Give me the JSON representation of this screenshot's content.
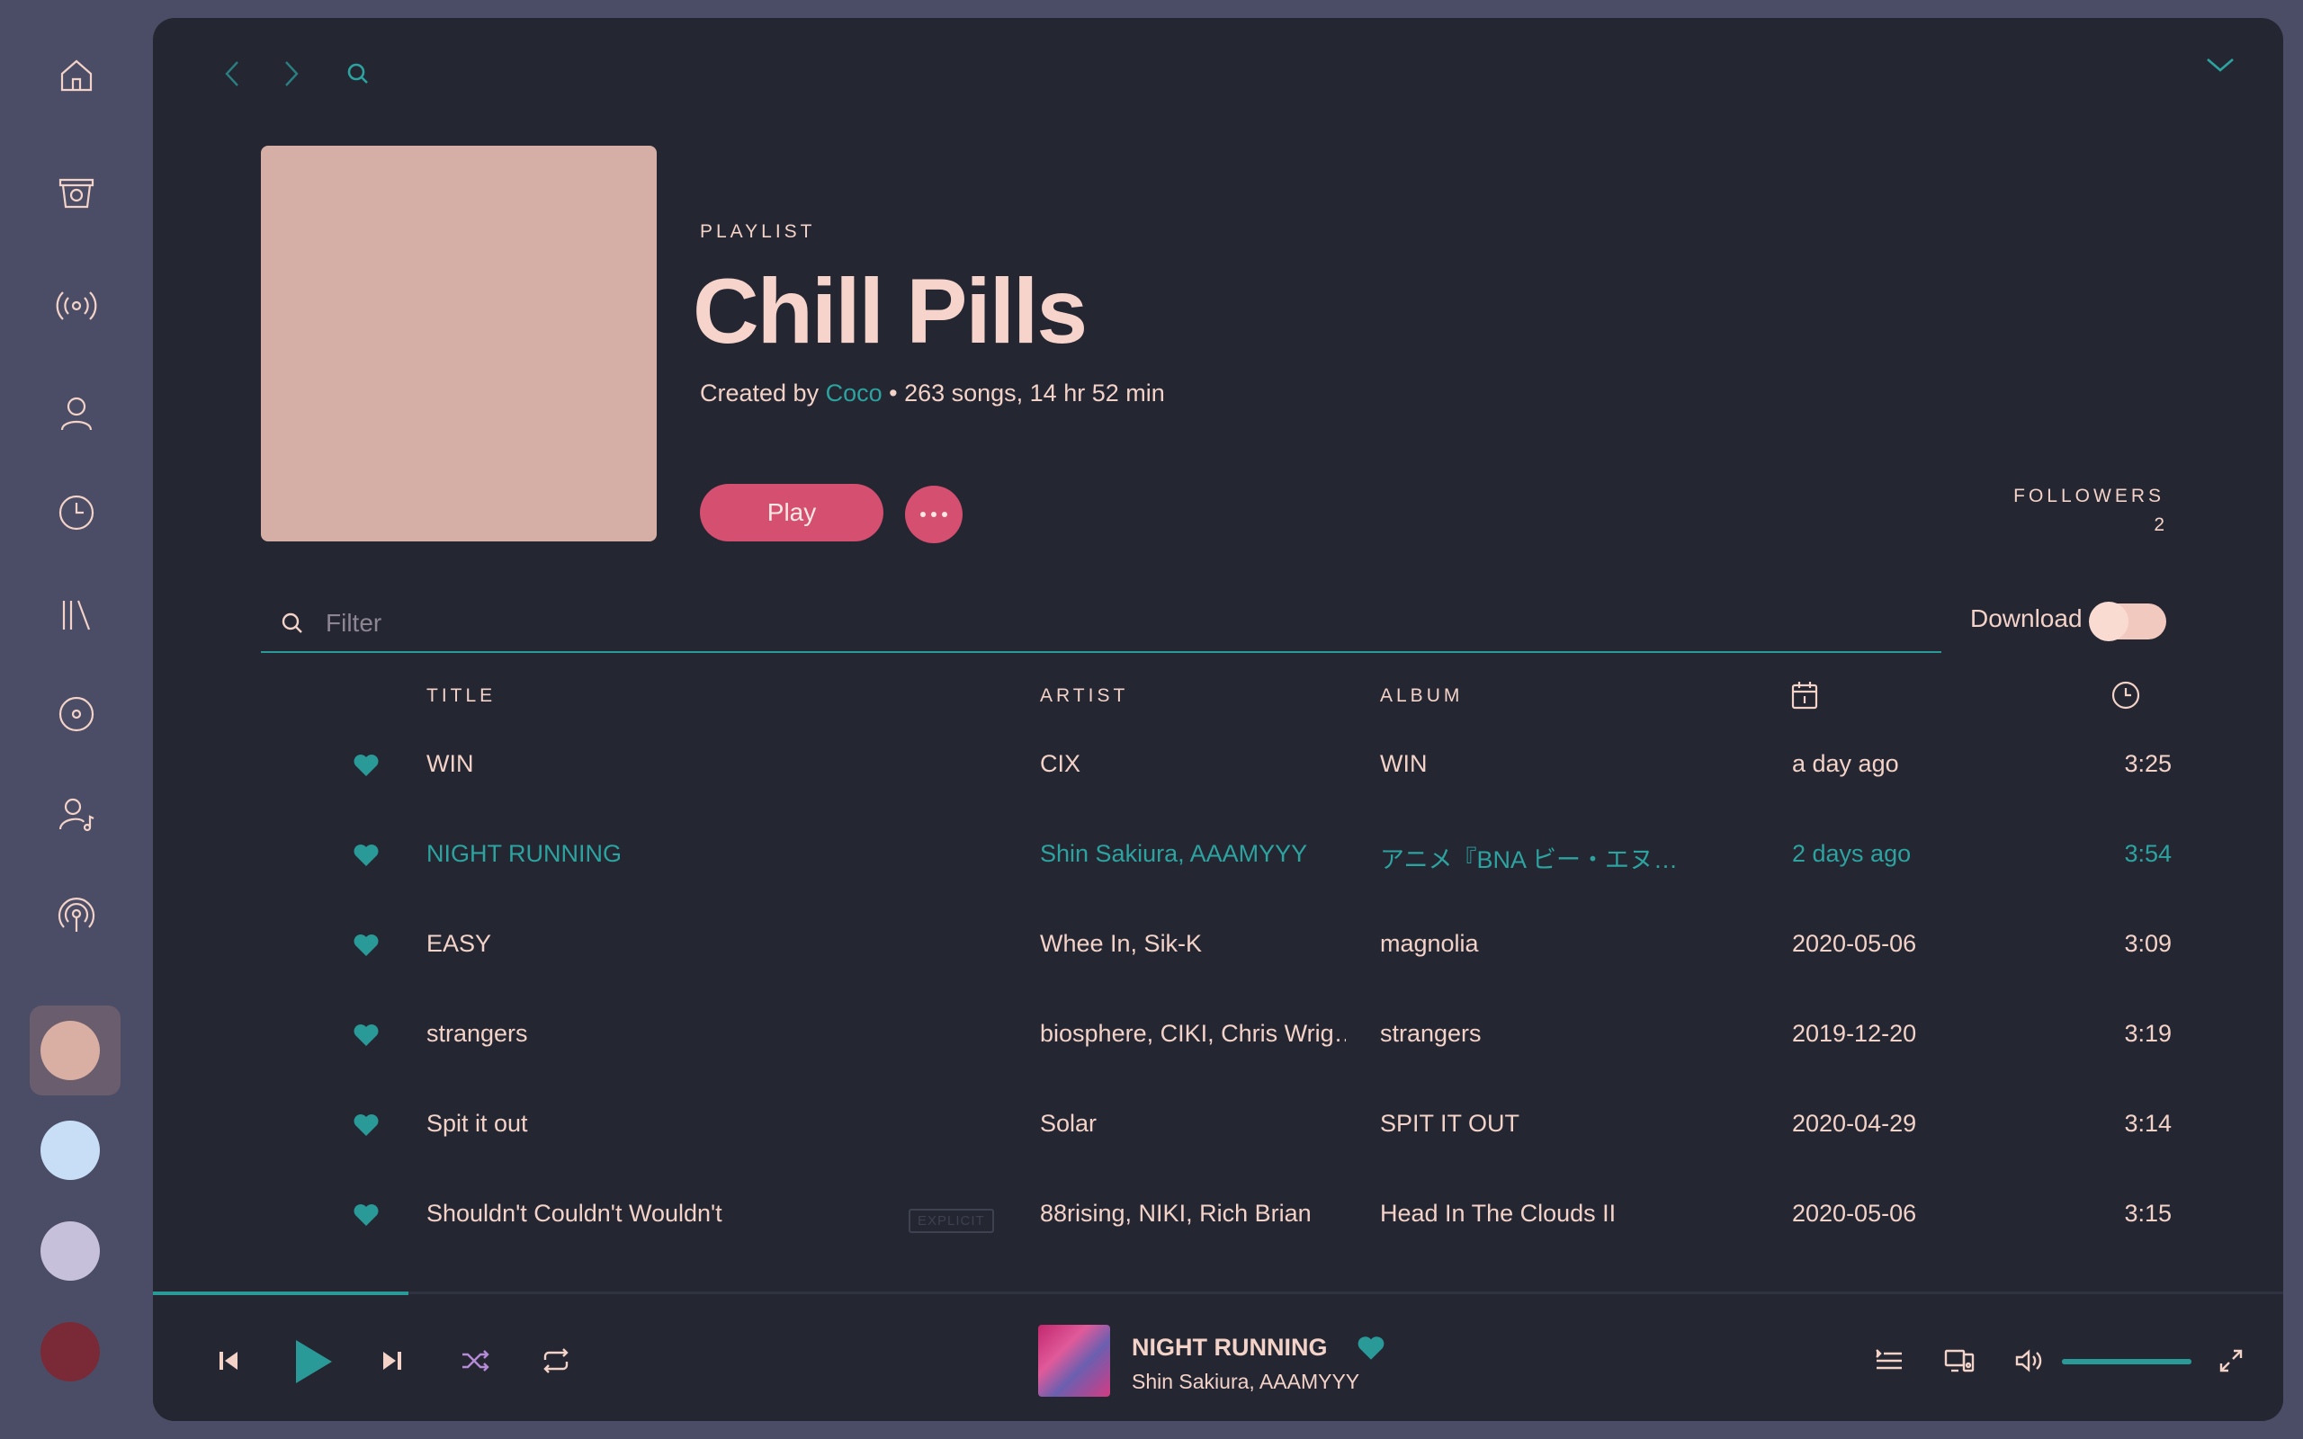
{
  "sidebar": {
    "icons": [
      "home-icon",
      "store-icon",
      "radio-icon",
      "profile-icon",
      "history-icon",
      "library-icon",
      "album-icon",
      "artists-icon",
      "podcast-icon"
    ]
  },
  "themes": [
    "#d9aea3",
    "#c8def6",
    "#c6c0da",
    "#7a2a36"
  ],
  "nav": {
    "back": "back-icon",
    "forward": "forward-icon",
    "search": "search-icon",
    "collapse": "chevron-down-icon"
  },
  "playlist": {
    "kicker": "PLAYLIST",
    "title": "Chill Pills",
    "created_by_prefix": "Created by ",
    "creator": "Coco",
    "stats": " • 263 songs, 14 hr 52 min",
    "play_label": "Play",
    "followers_label": "FOLLOWERS",
    "followers_count": "2"
  },
  "filter": {
    "placeholder": "Filter"
  },
  "download": {
    "label": "Download",
    "enabled": false
  },
  "columns": {
    "title": "TITLE",
    "artist": "ARTIST",
    "album": "ALBUM"
  },
  "tracks": [
    {
      "title": "WIN",
      "artist": "CIX",
      "album": "WIN",
      "added": "a day ago",
      "duration": "3:25",
      "liked": true,
      "explicit": ""
    },
    {
      "title": "NIGHT RUNNING",
      "artist": "Shin Sakiura, AAAMYYY",
      "album": "アニメ『BNA ビー・エヌ…",
      "added": "2 days ago",
      "duration": "3:54",
      "liked": true,
      "explicit": "",
      "active": true
    },
    {
      "title": "EASY",
      "artist": "Whee In, Sik-K",
      "album": "magnolia",
      "added": "2020-05-06",
      "duration": "3:09",
      "liked": true,
      "explicit": ""
    },
    {
      "title": "strangers",
      "artist": "biosphere, CIKI, Chris Wrig…",
      "album": "strangers",
      "added": "2019-12-20",
      "duration": "3:19",
      "liked": true,
      "explicit": ""
    },
    {
      "title": "Spit it out",
      "artist": "Solar",
      "album": "SPIT IT OUT",
      "added": "2020-04-29",
      "duration": "3:14",
      "liked": true,
      "explicit": ""
    },
    {
      "title": "Shouldn't Couldn't Wouldn't",
      "artist": "88rising, NIKI, Rich Brian",
      "album": "Head In The Clouds II",
      "added": "2020-05-06",
      "duration": "3:15",
      "liked": true,
      "explicit": "EXPLICIT"
    }
  ],
  "now_playing": {
    "title": "NIGHT RUNNING",
    "artist": "Shin Sakiura, AAAMYYY",
    "liked": true,
    "progress": 0.12,
    "volume": 1.0
  },
  "colors": {
    "accent": "#2a9a98",
    "brand": "#d44f70",
    "text": "#f3d2c8",
    "background": "#242632"
  }
}
